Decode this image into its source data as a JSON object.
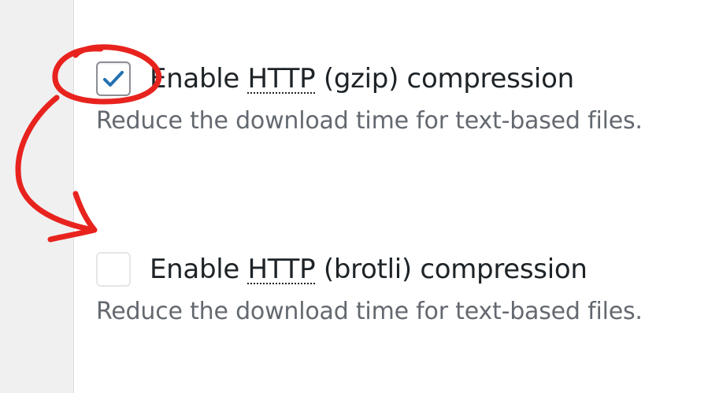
{
  "options": [
    {
      "id": "gzip",
      "checked": true,
      "label_prefix": "Enable",
      "label_abbr": "HTTP",
      "label_suffix": "(gzip) compression",
      "description": "Reduce the download time for text-based files."
    },
    {
      "id": "brotli",
      "checked": false,
      "label_prefix": "Enable",
      "label_abbr": "HTTP",
      "label_suffix": "(brotli) compression",
      "description": "Reduce the download time for text-based files."
    }
  ],
  "icons": {
    "checkmark": "checkmark-icon"
  },
  "colors": {
    "check_blue": "#2271b1",
    "annotation_red": "#e8231e",
    "text_primary": "#1d2327",
    "text_muted": "#646970"
  }
}
